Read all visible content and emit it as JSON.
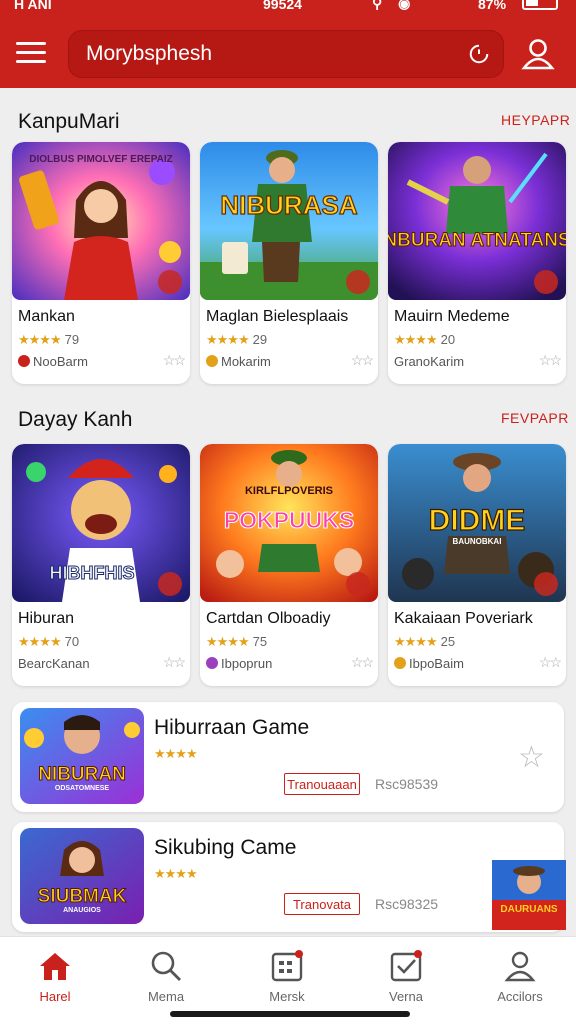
{
  "status_bar": {
    "carrier": "H ANI",
    "time": "99524",
    "battery": "87%"
  },
  "header": {
    "search_value": "Morybsphesh"
  },
  "sections": [
    {
      "title": "KanpuMari",
      "see_all": "HEYPAPR",
      "games": [
        {
          "name": "Mankan",
          "rating": "79",
          "publisher": "NooBarm",
          "stars": "★★★★",
          "art_text": "",
          "top_text": "DIOLBUS PIMOLVEF EREPAIZ",
          "pub_color": "#c9221c"
        },
        {
          "name": "Maglan Bielesplaais",
          "rating": "29",
          "publisher": "Mokarim",
          "stars": "★★★★",
          "art_text": "NIBURASA",
          "top_text": "",
          "pub_color": "#e3a11a"
        },
        {
          "name": "Mauirn Medeme",
          "rating": "20",
          "publisher": "GranoKarim",
          "stars": "★★★★",
          "art_text": "NBURAN ATNATANS",
          "top_text": "",
          "pub_color": ""
        }
      ]
    },
    {
      "title": "Dayay Kanh",
      "see_all": "FEVPAPR",
      "games": [
        {
          "name": "Hiburan",
          "rating": "70",
          "publisher": "BearcKanan",
          "stars": "★★★★",
          "art_text": "HIBHFHIS",
          "top_text": "",
          "pub_color": ""
        },
        {
          "name": "Cartdan Olboadiy",
          "rating": "75",
          "publisher": "Ibpoprun",
          "stars": "★★★★",
          "art_text": "POKPUUKS",
          "top_text": "KIRLFLPOVERIS",
          "pub_color": "#9b3fbf"
        },
        {
          "name": "Kakaiaan Poveriark",
          "rating": "25",
          "publisher": "IbpoBaim",
          "stars": "★★★★",
          "art_text": "DIDME",
          "top_text": "BAUNOBKAI",
          "pub_color": "#e3a11a"
        }
      ]
    }
  ],
  "featured": [
    {
      "title": "Hiburraan Game",
      "stars": "★★★★",
      "button": "Tranouaaan",
      "size": "Rsc98539",
      "art_text": "NIBURAN",
      "sub_text": "ODSATOMNESE"
    },
    {
      "title": "Sikubing Came",
      "stars": "★★★★",
      "button": "Tranovata",
      "size": "Rsc98325",
      "art_text": "SIUBMAK",
      "sub_text": "ANAUGIOS"
    }
  ],
  "floating_art_text": "DAURUANS",
  "bottom_nav": [
    {
      "label": "Harel",
      "icon": "home-icon",
      "active": true
    },
    {
      "label": "Mema",
      "icon": "search-icon",
      "active": false
    },
    {
      "label": "Mersk",
      "icon": "grid-icon",
      "active": false
    },
    {
      "label": "Verna",
      "icon": "checkbox-icon",
      "active": false
    },
    {
      "label": "Accilors",
      "icon": "user-icon",
      "active": false
    }
  ],
  "colors": {
    "brand": "#c9221c",
    "star": "#e3a11a"
  }
}
